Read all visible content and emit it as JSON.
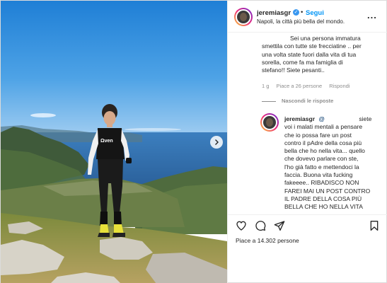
{
  "header": {
    "username": "jeremiasgr",
    "verified_mark": "✓",
    "separator": "•",
    "follow_label": "Segui",
    "location": "Napoli, la città più bella del mondo.",
    "more_label": "..."
  },
  "comment_1": {
    "lines": [
      "Sei una persona immatura",
      "smettila con tutte ste frecciatine .. per",
      "una volta state fuori dalla vita di tua",
      "sorella, come fa ma famiglia di",
      "stefano!! Siete pesanti.."
    ],
    "time": "1 g",
    "likes": "Piace a 26 persone",
    "reply_label": "Rispondi"
  },
  "hide_replies_label": "Nascondi le risposte",
  "reply_1": {
    "username": "jeremiasgr",
    "mention": "@",
    "lines": [
      "siete",
      "voi i malati mentali a pensare",
      "che io possa fare un post",
      "contro il pAdre della cosa più",
      "bella che ho nella vita... quello",
      "che dovevo parlare con ste,",
      "l'ho già fatto e mettendoci la",
      "faccia. Buona vita fucking",
      "fakeeee.. RIBADISCO NON",
      "FAREI MAI UN POST CONTRO",
      "IL PADRE DELLA COSA PIÙ",
      "BELLA CHE HO NELLA VITA"
    ]
  },
  "likes_text": "Piace a 14.302 persone",
  "icons": [
    "heart-icon",
    "comment-icon",
    "share-icon",
    "bookmark-icon",
    "chevron-right-icon"
  ]
}
